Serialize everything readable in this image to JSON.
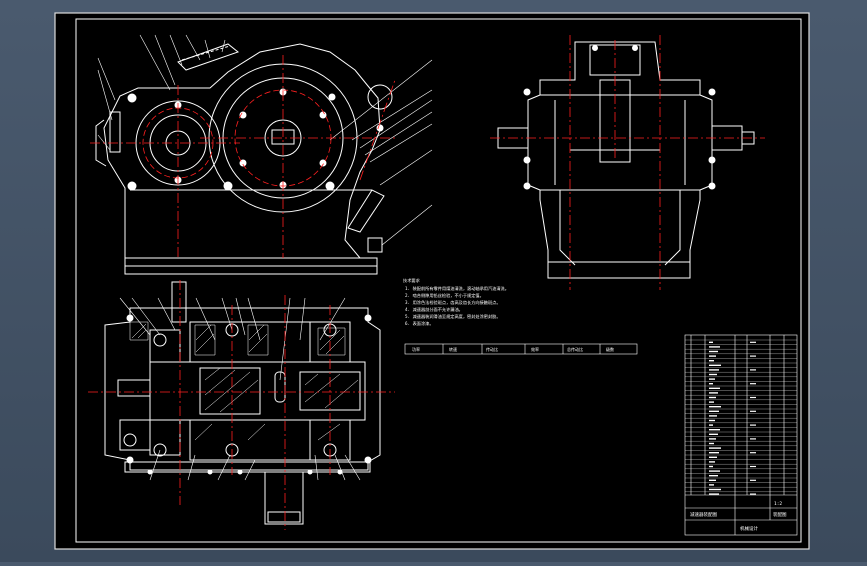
{
  "colors": {
    "background": "#3f4e61",
    "sheet": "#000000",
    "line": "#ffffff",
    "center_line": "#ff2020",
    "dim": "#ff4040",
    "hatch": "#ffffff"
  },
  "notes": {
    "heading": "技术要求",
    "lines": [
      "1. 装配前所有零件用煤油清洗，滚动轴承用汽油清洗。",
      "2. 啮合侧隙用铅丝检验，不小于规定值。",
      "3. 用涂色法检验斑点，齿高及齿长方向接触斑点。",
      "4. 减速器剖分面不允许漏油。",
      "5. 减速器装润滑油至规定高度，密封处涂密封胶。",
      "6. 表面涂漆。"
    ]
  },
  "spec_table": {
    "headers": [
      "功率",
      "转速",
      "传动比",
      "效率",
      "总传动比",
      "级数"
    ]
  },
  "title_block": {
    "drawing_name": "减速器装配图",
    "school": "机械设计",
    "scale": "1:2",
    "sheet_label": "装配图"
  },
  "icons": {
    "view_front": "gearbox-front-view",
    "view_side": "gearbox-side-view",
    "view_top": "gearbox-top-view"
  }
}
